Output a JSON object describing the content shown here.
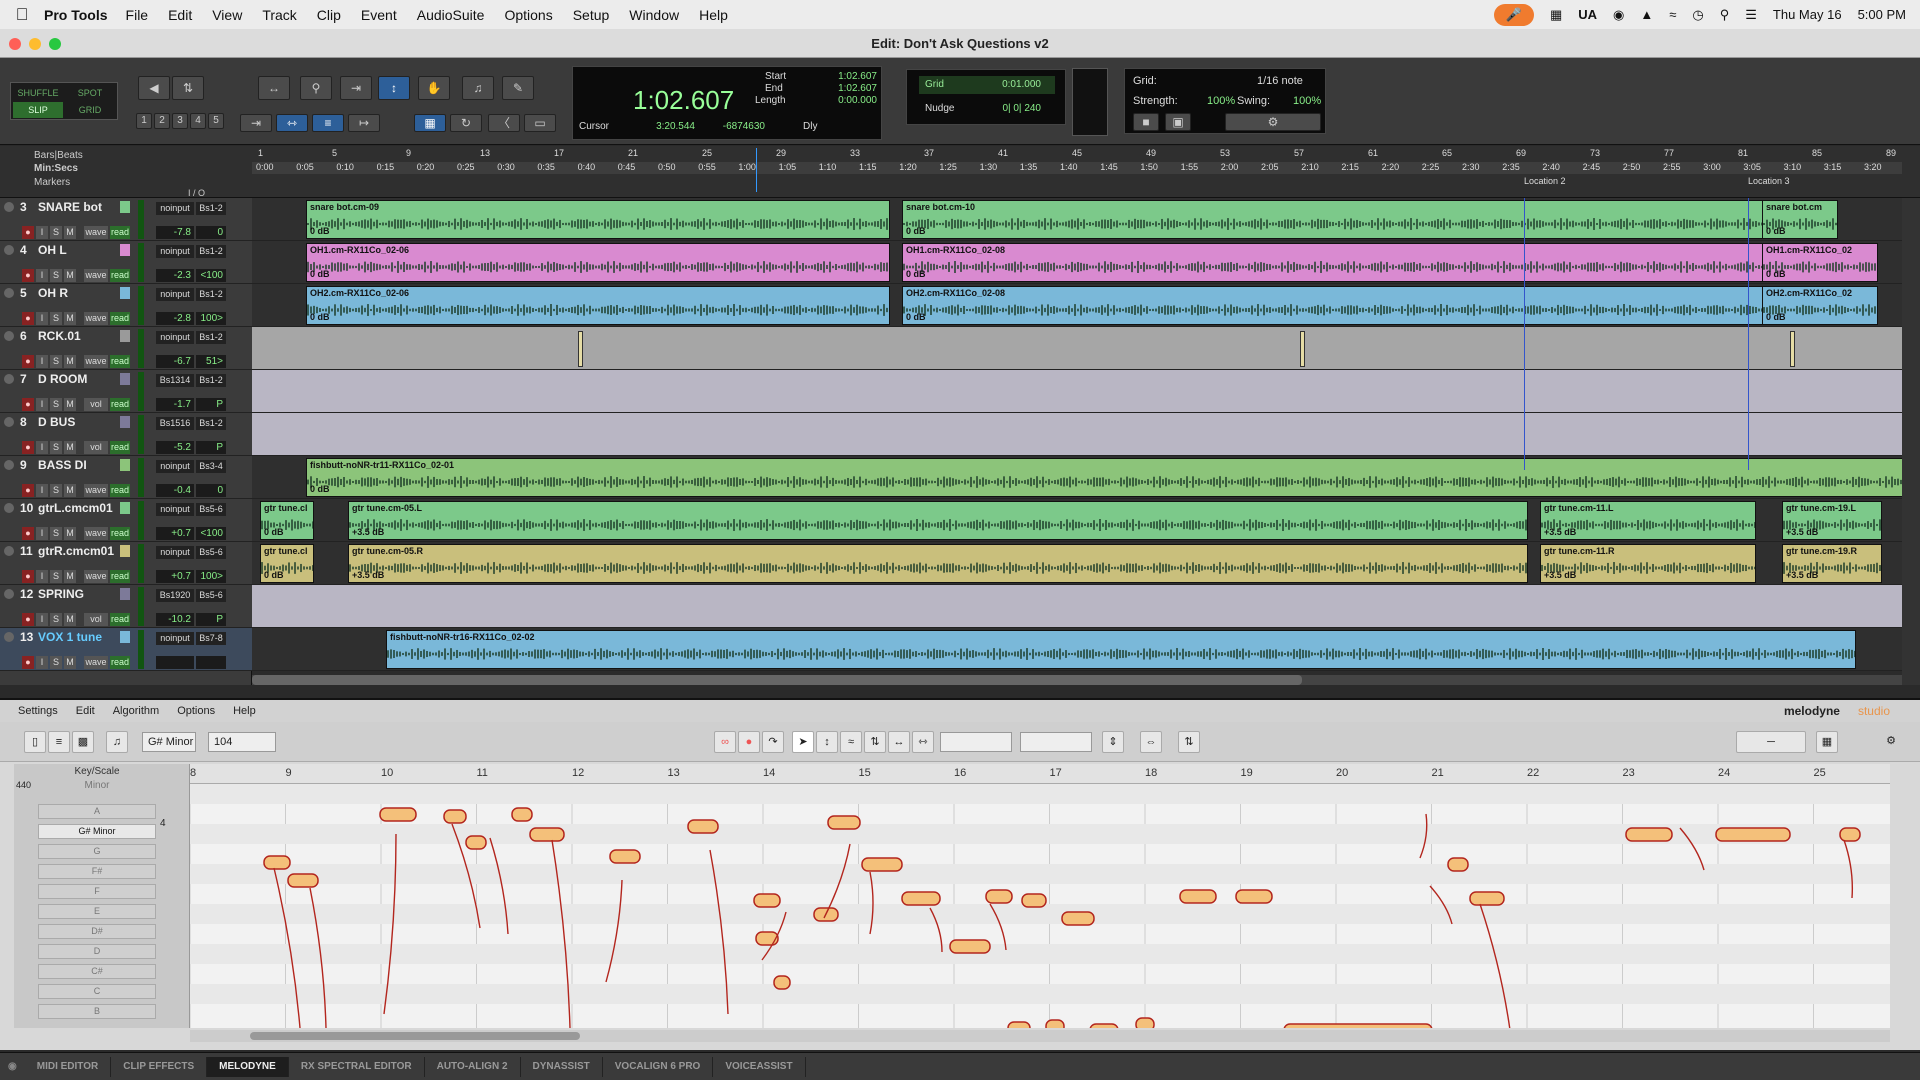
{
  "menubar": {
    "app": "Pro Tools",
    "items": [
      "File",
      "Edit",
      "View",
      "Track",
      "Clip",
      "Event",
      "AudioSuite",
      "Options",
      "Setup",
      "Window",
      "Help"
    ],
    "ua": "UA",
    "datetime": "Thu May 16",
    "time": "5:00 PM"
  },
  "window": {
    "title": "Edit: Don't Ask Questions v2"
  },
  "modes": {
    "shuffle": "SHUFFLE",
    "spot": "SPOT",
    "slip": "SLIP",
    "grid": "GRID"
  },
  "zoom_presets": [
    "1",
    "2",
    "3",
    "4",
    "5"
  ],
  "counter": {
    "main": "1:02.607",
    "start_label": "Start",
    "end_label": "End",
    "length_label": "Length",
    "start": "1:02.607",
    "end": "1:02.607",
    "length": "0:00.000",
    "cursor_label": "Cursor",
    "cursor": "3:20.544",
    "sample": "-6874630",
    "dly": "Dly"
  },
  "grid": {
    "label": "Grid",
    "value": "0:01.000",
    "nudge_label": "Nudge",
    "nudge_value": "0| 0| 240"
  },
  "rgrid": {
    "grid_label": "Grid:",
    "grid_value": "1/16 note",
    "strength_label": "Strength:",
    "strength": "100%",
    "swing_label": "Swing:",
    "swing": "100%"
  },
  "ruler": {
    "bars_label": "Bars|Beats",
    "minsecs_label": "Min:Secs",
    "markers_label": "Markers",
    "io_label": "I / O",
    "bars": [
      "1",
      "5",
      "9",
      "13",
      "17",
      "21",
      "25",
      "29",
      "33",
      "37",
      "41",
      "45",
      "49",
      "53",
      "57",
      "61",
      "65",
      "69",
      "73",
      "77",
      "81",
      "85",
      "89"
    ],
    "secs": [
      "0:00",
      "0:05",
      "0:10",
      "0:15",
      "0:20",
      "0:25",
      "0:30",
      "0:35",
      "0:40",
      "0:45",
      "0:50",
      "0:55",
      "1:00",
      "1:05",
      "1:10",
      "1:15",
      "1:20",
      "1:25",
      "1:30",
      "1:35",
      "1:40",
      "1:45",
      "1:50",
      "1:55",
      "2:00",
      "2:05",
      "2:10",
      "2:15",
      "2:20",
      "2:25",
      "2:30",
      "2:35",
      "2:40",
      "2:45",
      "2:50",
      "2:55",
      "3:00",
      "3:05",
      "3:10",
      "3:15",
      "3:20"
    ],
    "markers": [
      "Location 2",
      "Location 3"
    ]
  },
  "tracks": [
    {
      "num": "3",
      "name": "SNARE bot",
      "in": "noinput",
      "out": "Bs1-2",
      "vol": "-7.8",
      "pan": "0",
      "mode": "wave",
      "auto": "read",
      "color": "#7cc98a",
      "clips": [
        {
          "name": "snare bot.cm-09",
          "gain": "0 dB"
        },
        {
          "name": "snare bot.cm-10",
          "gain": "0 dB"
        },
        {
          "name": "snare bot.cm",
          "gain": "0 dB"
        }
      ]
    },
    {
      "num": "4",
      "name": "OH L",
      "in": "noinput",
      "out": "Bs1-2",
      "vol": "-2.3",
      "pan": "<100",
      "mode": "wave",
      "auto": "read",
      "color": "#d98ad0",
      "clips": [
        {
          "name": "OH1.cm-RX11Co_02-06",
          "gain": "0 dB"
        },
        {
          "name": "OH1.cm-RX11Co_02-08",
          "gain": "0 dB"
        },
        {
          "name": "OH1.cm-RX11Co_02",
          "gain": "0 dB"
        }
      ]
    },
    {
      "num": "5",
      "name": "OH R",
      "in": "noinput",
      "out": "Bs1-2",
      "vol": "-2.8",
      "pan": "100>",
      "mode": "wave",
      "auto": "read",
      "color": "#7ab8d9",
      "clips": [
        {
          "name": "OH2.cm-RX11Co_02-06",
          "gain": "0 dB"
        },
        {
          "name": "OH2.cm-RX11Co_02-08",
          "gain": "0 dB"
        },
        {
          "name": "OH2.cm-RX11Co_02",
          "gain": "0 dB"
        }
      ]
    },
    {
      "num": "6",
      "name": "RCK.01",
      "in": "noinput",
      "out": "Bs1-2",
      "vol": "-6.7",
      "pan": "51>",
      "mode": "wave",
      "auto": "read",
      "color": "#9a9a9a",
      "clips": []
    },
    {
      "num": "7",
      "name": "D ROOM",
      "in": "Bs1314",
      "out": "Bs1-2",
      "vol": "-1.7",
      "pan": "P",
      "mode": "vol",
      "auto": "read",
      "color": "#7d7a99",
      "clips": []
    },
    {
      "num": "8",
      "name": "D BUS",
      "in": "Bs1516",
      "out": "Bs1-2",
      "vol": "-5.2",
      "pan": "P",
      "mode": "vol",
      "auto": "read",
      "color": "#7d7a99",
      "clips": []
    },
    {
      "num": "9",
      "name": "BASS DI",
      "in": "noinput",
      "out": "Bs3-4",
      "vol": "-0.4",
      "pan": "0",
      "mode": "wave",
      "auto": "read",
      "color": "#8cc47a",
      "clips": [
        {
          "name": "fishbutt-noNR-tr11-RX11Co_02-01",
          "gain": "0 dB"
        }
      ]
    },
    {
      "num": "10",
      "name": "gtrL.cmcm01",
      "in": "noinput",
      "out": "Bs5-6",
      "vol": "+0.7",
      "pan": "<100",
      "mode": "wave",
      "auto": "read",
      "color": "#7cc98a",
      "clips": [
        {
          "name": "gtr tune.cl",
          "gain": "0 dB"
        },
        {
          "name": "gtr tune.cm-05.L",
          "gain": "+3.5 dB"
        },
        {
          "name": "gtr tune.cm-11.L",
          "gain": "+3.5 dB"
        },
        {
          "name": "gtr tune.cm-19.L",
          "gain": "+3.5 dB"
        }
      ]
    },
    {
      "num": "11",
      "name": "gtrR.cmcm01",
      "in": "noinput",
      "out": "Bs5-6",
      "vol": "+0.7",
      "pan": "100>",
      "mode": "wave",
      "auto": "read",
      "color": "#c9bf7c",
      "clips": [
        {
          "name": "gtr tune.cl",
          "gain": "0 dB"
        },
        {
          "name": "gtr tune.cm-05.R",
          "gain": "+3.5 dB"
        },
        {
          "name": "gtr tune.cm-11.R",
          "gain": "+3.5 dB"
        },
        {
          "name": "gtr tune.cm-19.R",
          "gain": "+3.5 dB"
        }
      ]
    },
    {
      "num": "12",
      "name": "SPRING",
      "in": "Bs1920",
      "out": "Bs5-6",
      "vol": "-10.2",
      "pan": "P",
      "mode": "vol",
      "auto": "read",
      "color": "#7d7a99",
      "clips": []
    },
    {
      "num": "13",
      "name": "VOX 1 tune",
      "in": "noinput",
      "out": "Bs7-8",
      "vol": "",
      "pan": "",
      "mode": "wave",
      "auto": "read",
      "color": "#7ab8d9",
      "clips": [
        {
          "name": "fishbutt-noNR-tr16-RX11Co_02-02",
          "gain": ""
        }
      ]
    }
  ],
  "melodyne": {
    "menu": [
      "Settings",
      "Edit",
      "Algorithm",
      "Options",
      "Help"
    ],
    "brand": "melodyne",
    "edition": "studio",
    "key": "G# Minor",
    "tempo": "104",
    "ref": "440",
    "scale_header": "Key/Scale",
    "scale_mode": "Minor",
    "scale_sel": "G# Minor",
    "count": "4",
    "notes": [
      "A",
      "G# Minor",
      "G",
      "F#",
      "F",
      "E",
      "D#",
      "D",
      "C#",
      "C",
      "B"
    ],
    "bars": [
      "8",
      "9",
      "10",
      "11",
      "12",
      "13",
      "14",
      "15",
      "16",
      "17",
      "18",
      "19",
      "20",
      "21",
      "22",
      "23",
      "24",
      "25"
    ]
  },
  "tabs": [
    "MIDI EDITOR",
    "CLIP EFFECTS",
    "MELODYNE",
    "RX SPECTRAL EDITOR",
    "AUTO-ALIGN 2",
    "DYNASSIST",
    "VOCALIGN 6 PRO",
    "VOICEASSIST"
  ],
  "active_tab": "MELODYNE"
}
